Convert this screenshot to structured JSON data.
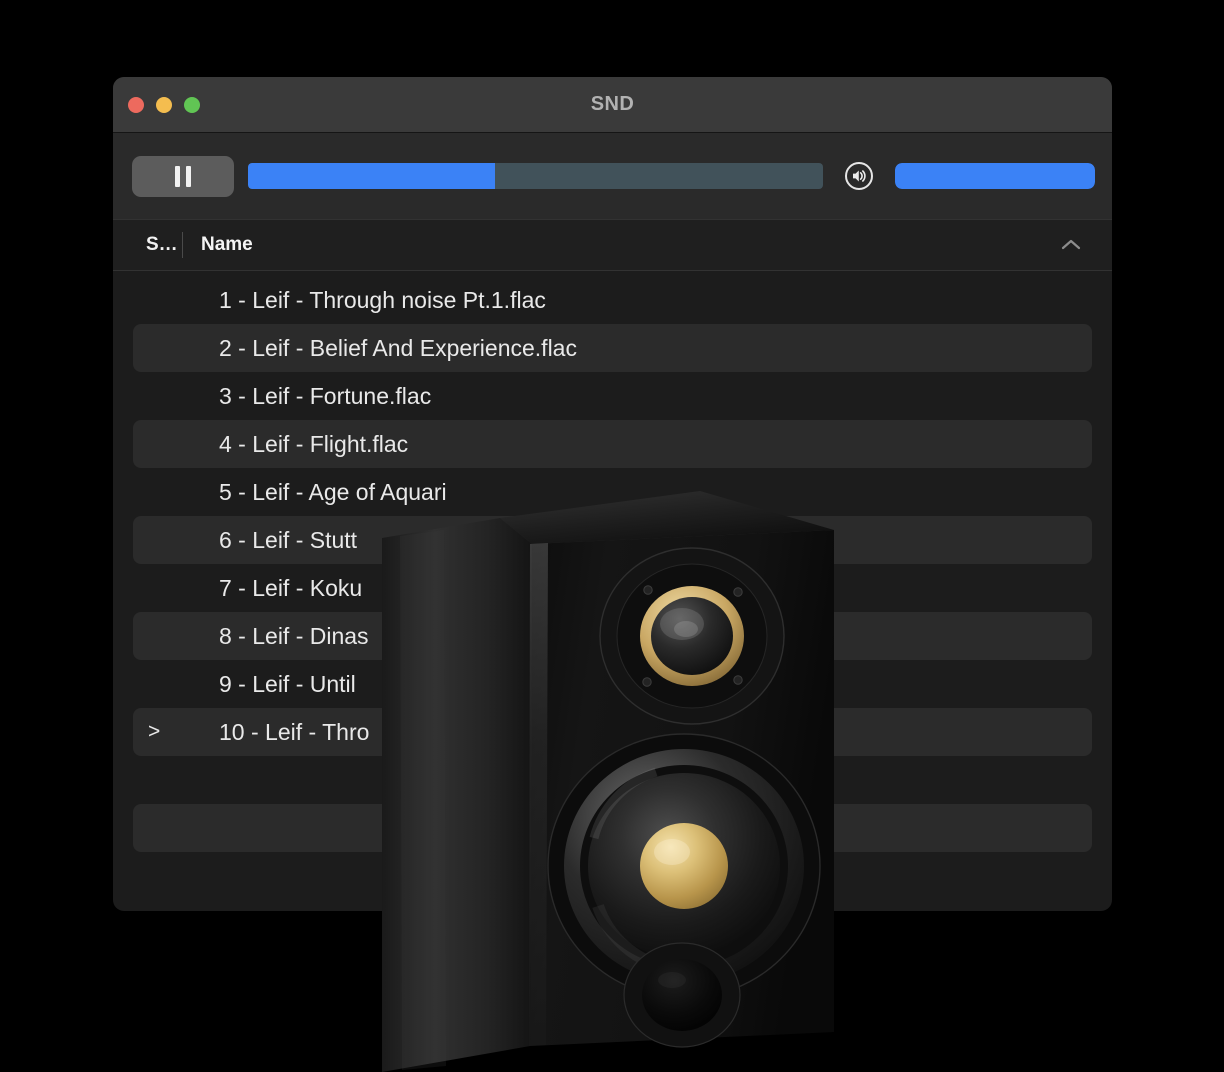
{
  "window": {
    "title": "SND",
    "traffic_lights": [
      {
        "name": "close",
        "color": "#ed6a5e"
      },
      {
        "name": "minimize",
        "color": "#f4bd4f"
      },
      {
        "name": "maximize",
        "color": "#61c554"
      }
    ]
  },
  "toolbar": {
    "play_pause_state": "pause",
    "play_pause_icon": "pause-icon",
    "seek": {
      "progress_percent": 43,
      "fill_color": "#3b82f6",
      "track_color": "#41525a"
    },
    "volume_icon": "speaker-wave-icon",
    "volume": {
      "level_percent": 100,
      "fill_color": "#3b82f6"
    }
  },
  "list_header": {
    "status_column": "S…",
    "name_column": "Name",
    "sort_direction_icon": "chevron-up-icon"
  },
  "tracks": [
    {
      "status": "",
      "name": "1 - Leif - Through noise Pt.1.flac"
    },
    {
      "status": "",
      "name": "2 - Leif - Belief And Experience.flac"
    },
    {
      "status": "",
      "name": "3 - Leif - Fortune.flac"
    },
    {
      "status": "",
      "name": "4 - Leif - Flight.flac"
    },
    {
      "status": "",
      "name": "5 - Leif - Age of Aquari"
    },
    {
      "status": "",
      "name": "6 - Leif - Stutt"
    },
    {
      "status": "",
      "name": "7 - Leif - Koku"
    },
    {
      "status": "",
      "name": "8 - Leif - Dinas"
    },
    {
      "status": "",
      "name": "9 - Leif - Until"
    },
    {
      "status": ">",
      "name": "10 - Leif - Thro"
    }
  ],
  "overlay": {
    "image": "bookshelf-speaker-photo"
  },
  "colors": {
    "accent": "#3b82f6",
    "titlebar": "#3a3a3a",
    "toolbar": "#2a2a2a",
    "list_background": "#1c1c1c",
    "row_zebra": "#2b2b2b",
    "desktop": "#000000"
  }
}
